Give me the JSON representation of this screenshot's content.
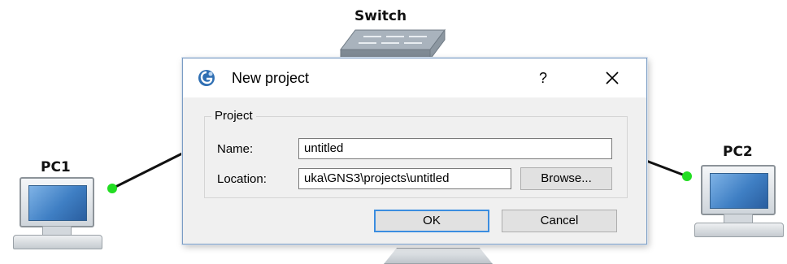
{
  "topology": {
    "switch_label": "Switch",
    "pc1_label": "PC1",
    "pc2_label": "PC2",
    "link_status_color": "#22dd22"
  },
  "dialog": {
    "title": "New project",
    "help_label": "?",
    "close_icon": "close-icon",
    "group_title": "Project",
    "name_label": "Name:",
    "name_value": "untitled",
    "location_label": "Location:",
    "location_value": "uka\\GNS3\\projects\\untitled",
    "browse_label": "Browse...",
    "ok_label": "OK",
    "cancel_label": "Cancel",
    "accent_color": "#3b8de0"
  }
}
